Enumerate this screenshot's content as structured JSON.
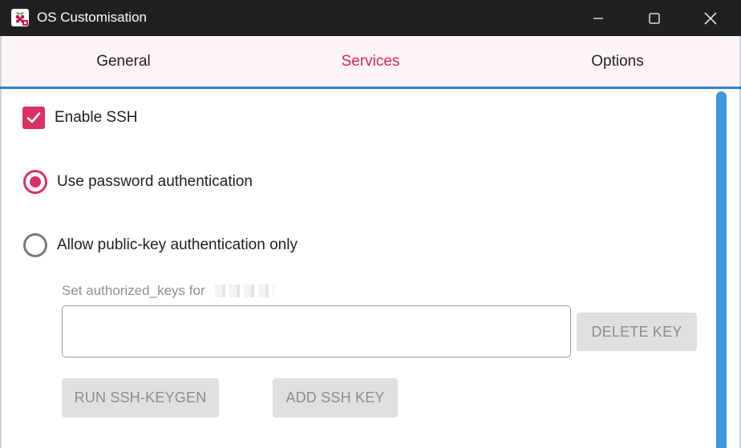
{
  "window": {
    "title": "OS Customisation",
    "icon": "raspberry-pi-icon",
    "controls": [
      "minimize-icon",
      "maximize-icon",
      "close-icon"
    ]
  },
  "tabs": [
    {
      "label": "General",
      "active": false
    },
    {
      "label": "Services",
      "active": true
    },
    {
      "label": "Options",
      "active": false
    }
  ],
  "services": {
    "enable_ssh": {
      "label": "Enable SSH",
      "checked": true
    },
    "auth_password": {
      "label": "Use password authentication",
      "selected": true
    },
    "auth_pubkey": {
      "label": "Allow public-key authentication only",
      "selected": false
    },
    "authorized_keys_label": "Set authorized_keys for",
    "authorized_keys_value": "",
    "delete_key_label": "DELETE KEY",
    "run_keygen_label": "RUN SSH-KEYGEN",
    "add_key_label": "ADD SSH KEY"
  },
  "colors": {
    "accent": "#dc2f62",
    "titlebar": "#202020",
    "tabbar_bg": "#fcf4f7",
    "tab_underline": "#2a7fc8",
    "scrollbar": "#3d97d8",
    "button_disabled_bg": "#e0e0e0"
  }
}
